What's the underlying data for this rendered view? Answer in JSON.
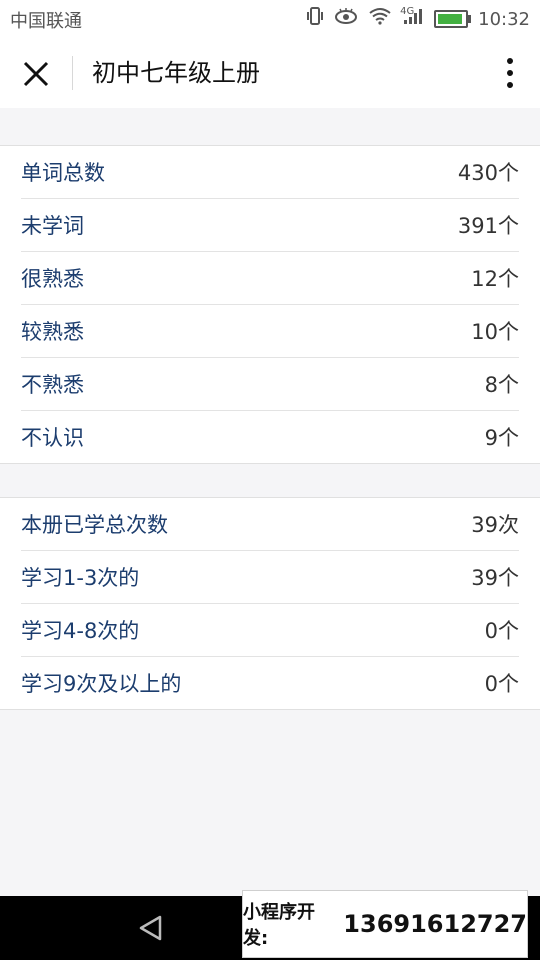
{
  "status_bar": {
    "carrier": "中国联通",
    "network": "4G",
    "time": "10:32",
    "icons": [
      "vibrate-icon",
      "eye-icon",
      "wifi-icon",
      "signal-icon",
      "battery-icon"
    ]
  },
  "nav": {
    "title": "初中七年级上册",
    "close_icon": "close-icon",
    "more_icon": "more-vertical-icon"
  },
  "word_stats": [
    {
      "label": "单词总数",
      "value": "430个"
    },
    {
      "label": "未学词",
      "value": "391个"
    },
    {
      "label": "很熟悉",
      "value": "12个"
    },
    {
      "label": "较熟悉",
      "value": "10个"
    },
    {
      "label": "不熟悉",
      "value": "8个"
    },
    {
      "label": "不认识",
      "value": "9个"
    }
  ],
  "study_stats": [
    {
      "label": "本册已学总次数",
      "value": "39次"
    },
    {
      "label": "学习1-3次的",
      "value": "39个"
    },
    {
      "label": "学习4-8次的",
      "value": "0个"
    },
    {
      "label": "学习9次及以上的",
      "value": "0个"
    }
  ],
  "promo": {
    "label": "小程序开发:",
    "phone": "13691612727"
  },
  "colors": {
    "label_text": "#1c3d6e",
    "battery": "#43b041"
  }
}
